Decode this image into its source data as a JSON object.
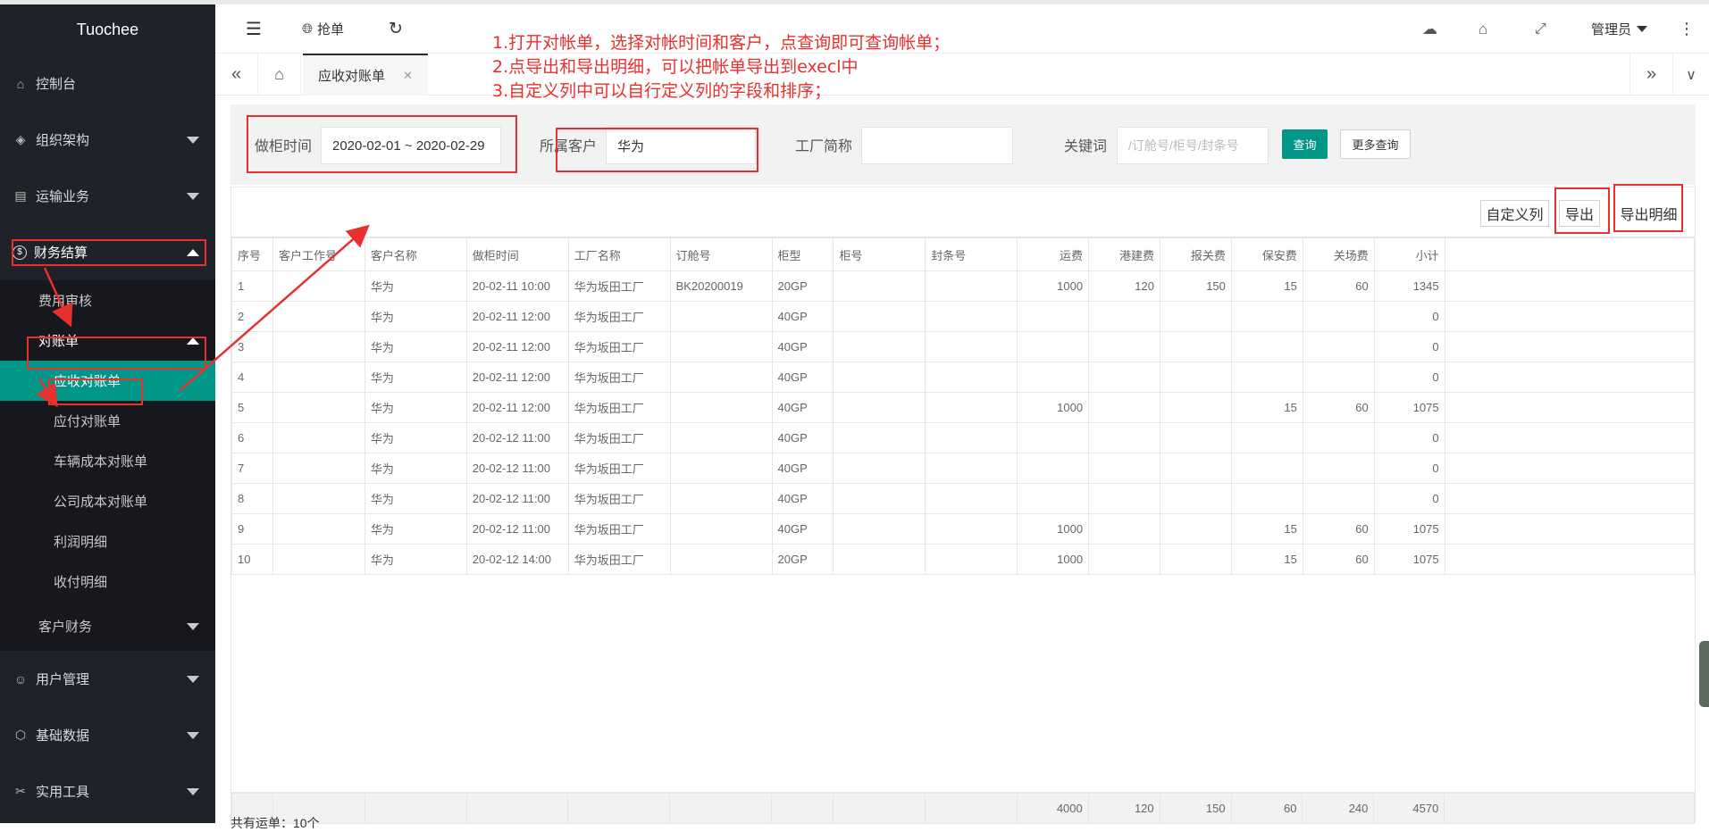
{
  "app": {
    "brand": "Tuochee"
  },
  "sidebar": {
    "items": [
      {
        "label": "控制台",
        "icon": "home-icon"
      },
      {
        "label": "组织架构",
        "icon": "layers-icon"
      },
      {
        "label": "运输业务",
        "icon": "document-icon"
      },
      {
        "label": "财务结算",
        "icon": "dollar-icon"
      }
    ],
    "finance_sub": [
      {
        "label": "费用审核"
      },
      {
        "label": "对账单"
      }
    ],
    "statement_sub": [
      {
        "label": "应收对账单"
      },
      {
        "label": "应付对账单"
      },
      {
        "label": "车辆成本对账单"
      },
      {
        "label": "公司成本对账单"
      },
      {
        "label": "利润明细"
      },
      {
        "label": "收付明细"
      }
    ],
    "customer_finance": {
      "label": "客户财务"
    },
    "bottom_items": [
      {
        "label": "用户管理",
        "icon": "user-icon"
      },
      {
        "label": "基础数据",
        "icon": "cube-icon"
      },
      {
        "label": "实用工具",
        "icon": "tools-icon"
      }
    ]
  },
  "header": {
    "grab_label": "抢单",
    "admin_label": "管理员"
  },
  "tabs": {
    "active": "应收对账单"
  },
  "annotation": {
    "line1": "1.打开对帐单，选择对帐时间和客户，点查询即可查询帐单；",
    "line2": "2.点导出和导出明细，可以把帐单导出到execl中",
    "line3": "3.自定义列中可以自行定义列的字段和排序；"
  },
  "filter": {
    "date_label": "做柜时间",
    "date_value": "2020-02-01 ~ 2020-02-29",
    "customer_label": "所属客户",
    "customer_value": "华为",
    "factory_label": "工厂简称",
    "factory_value": "",
    "keyword_label": "关键词",
    "keyword_placeholder": "/订舱号/柜号/封条号",
    "query_button": "查询",
    "more_button": "更多查询"
  },
  "toolbar": {
    "custom_columns": "自定义列",
    "export": "导出",
    "export_detail": "导出明细"
  },
  "table": {
    "columns": [
      "序号",
      "客户工作号",
      "客户名称",
      "做柜时间",
      "工厂名称",
      "订舱号",
      "柜型",
      "柜号",
      "封条号",
      "运费",
      "港建费",
      "报关费",
      "保安费",
      "关场费",
      "小计"
    ],
    "rows": [
      [
        "1",
        "",
        "华为",
        "20-02-11 10:00",
        "华为坂田工厂",
        "BK20200019",
        "20GP",
        "",
        "",
        "1000",
        "120",
        "150",
        "15",
        "60",
        "1345"
      ],
      [
        "2",
        "",
        "华为",
        "20-02-11 12:00",
        "华为坂田工厂",
        "",
        "40GP",
        "",
        "",
        "",
        "",
        "",
        "",
        "",
        "0"
      ],
      [
        "3",
        "",
        "华为",
        "20-02-11 12:00",
        "华为坂田工厂",
        "",
        "40GP",
        "",
        "",
        "",
        "",
        "",
        "",
        "",
        "0"
      ],
      [
        "4",
        "",
        "华为",
        "20-02-11 12:00",
        "华为坂田工厂",
        "",
        "40GP",
        "",
        "",
        "",
        "",
        "",
        "",
        "",
        "0"
      ],
      [
        "5",
        "",
        "华为",
        "20-02-11 12:00",
        "华为坂田工厂",
        "",
        "40GP",
        "",
        "",
        "1000",
        "",
        "",
        "15",
        "60",
        "1075"
      ],
      [
        "6",
        "",
        "华为",
        "20-02-12 11:00",
        "华为坂田工厂",
        "",
        "40GP",
        "",
        "",
        "",
        "",
        "",
        "",
        "",
        "0"
      ],
      [
        "7",
        "",
        "华为",
        "20-02-12 11:00",
        "华为坂田工厂",
        "",
        "40GP",
        "",
        "",
        "",
        "",
        "",
        "",
        "",
        "0"
      ],
      [
        "8",
        "",
        "华为",
        "20-02-12 11:00",
        "华为坂田工厂",
        "",
        "40GP",
        "",
        "",
        "",
        "",
        "",
        "",
        "",
        "0"
      ],
      [
        "9",
        "",
        "华为",
        "20-02-12 11:00",
        "华为坂田工厂",
        "",
        "40GP",
        "",
        "",
        "1000",
        "",
        "",
        "15",
        "60",
        "1075"
      ],
      [
        "10",
        "",
        "华为",
        "20-02-12 14:00",
        "华为坂田工厂",
        "",
        "20GP",
        "",
        "",
        "1000",
        "",
        "",
        "15",
        "60",
        "1075"
      ]
    ],
    "totals": [
      "",
      "",
      "",
      "",
      "",
      "",
      "",
      "",
      "",
      "4000",
      "120",
      "150",
      "60",
      "240",
      "4570"
    ]
  },
  "footer": {
    "total_text": "共有运单：10个"
  }
}
